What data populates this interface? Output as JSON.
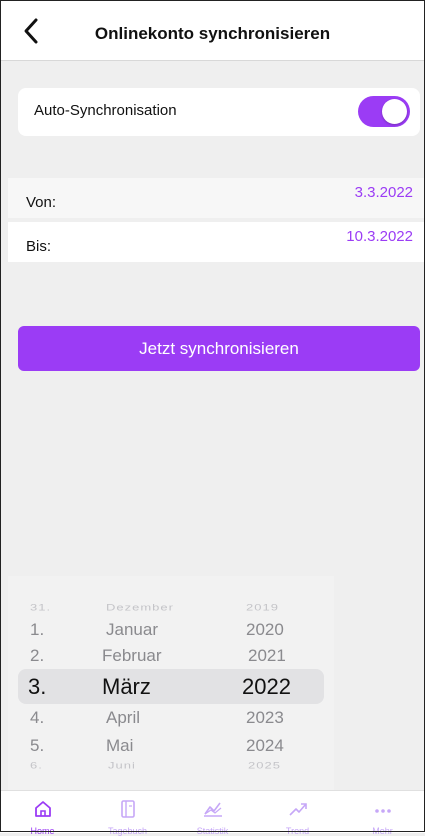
{
  "header": {
    "title": "Onlinekonto synchronisieren",
    "back_icon": "chevron-left-icon"
  },
  "auto_sync": {
    "label": "Auto-Synchronisation",
    "enabled": true
  },
  "date_range": {
    "from": {
      "label": "Von:",
      "value": "3.3.2022"
    },
    "to": {
      "label": "Bis:",
      "value": "10.3.2022"
    }
  },
  "sync_button": {
    "label": "Jetzt synchronisieren"
  },
  "picker": {
    "days": [
      "31.",
      "1.",
      "2.",
      "3.",
      "4.",
      "5.",
      "6."
    ],
    "months": [
      "Dezember",
      "Januar",
      "Februar",
      "März",
      "April",
      "Mai",
      "Juni"
    ],
    "years": [
      "2019",
      "2020",
      "2021",
      "2022",
      "2023",
      "2024",
      "2025"
    ],
    "selected": {
      "day": "3.",
      "month": "März",
      "year": "2022"
    }
  },
  "tabbar": {
    "items": [
      {
        "label": "Home",
        "icon": "home-icon"
      },
      {
        "label": "Tagebuch",
        "icon": "book-icon"
      },
      {
        "label": "Statistik",
        "icon": "chart-icon"
      },
      {
        "label": "Trend",
        "icon": "trend-icon"
      },
      {
        "label": "Mehr",
        "icon": "more-icon"
      }
    ],
    "active": "Home"
  },
  "colors": {
    "accent": "#9b3cf5",
    "background": "#efefef"
  }
}
